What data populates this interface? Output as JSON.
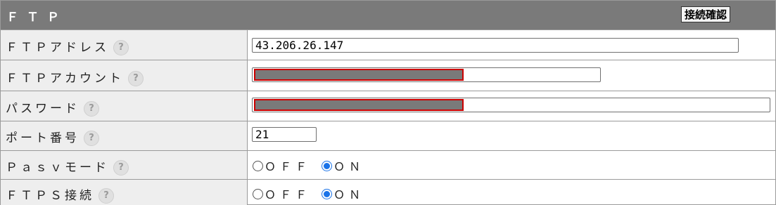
{
  "header": {
    "title": "ＦＴＰ",
    "confirm_button": "接続確認"
  },
  "help_symbol": "?",
  "fields": {
    "address": {
      "label": "ＦＴＰアドレス",
      "value": "43.206.26.147"
    },
    "account": {
      "label": "ＦＴＰアカウント",
      "value": ""
    },
    "password": {
      "label": "パスワード",
      "value": ""
    },
    "port": {
      "label": "ポート番号",
      "value": "21"
    },
    "pasv": {
      "label": "Ｐａｓｖモード",
      "options": [
        "ＯＦＦ",
        "ＯＮ"
      ],
      "selected": "ＯＮ"
    },
    "ftps": {
      "label": "ＦＴＰＳ接続",
      "options": [
        "ＯＦＦ",
        "ＯＮ"
      ],
      "selected": "ＯＮ"
    }
  },
  "colors": {
    "header_bg": "#7a7a7a",
    "label_bg": "#eeeeee",
    "redaction_border": "#cc0000",
    "radio_accent": "#1a73e8"
  }
}
